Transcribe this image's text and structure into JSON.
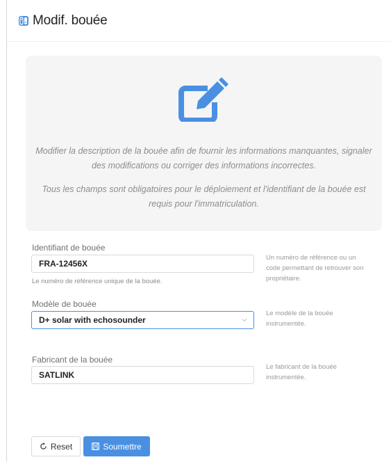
{
  "header": {
    "title": "Modif. bouée",
    "icon": "switch-app-icon",
    "accent": "#4a90e2"
  },
  "info": {
    "icon": "edit-icon",
    "text1": "Modifier la description de la bouée afin de fournir les informations manquantes, signaler des modifications ou corriger des informations incorrectes.",
    "text2": "Tous les champs sont obligatoires pour le déploiement et l'identifiant de la bouée est requis pour l'immatriculation."
  },
  "form": {
    "buoy_id": {
      "label": "Identifiant de bouée",
      "value": "FRA-12456X",
      "hint": "Le numéro de référence unique de la bouée.",
      "help": "Un numéro de référence ou un code permettant de retrouver son propriétaire."
    },
    "model": {
      "label": "Modèle de bouée",
      "value": "D+ solar with echosounder",
      "help": "Le modèle de la bouée instrumentée."
    },
    "manufacturer": {
      "label": "Fabricant de la bouée",
      "value": "SATLINK",
      "help": "Le fabricant de la bouée instrumentée."
    }
  },
  "actions": {
    "reset_label": "Reset",
    "submit_label": "Soumettre"
  }
}
